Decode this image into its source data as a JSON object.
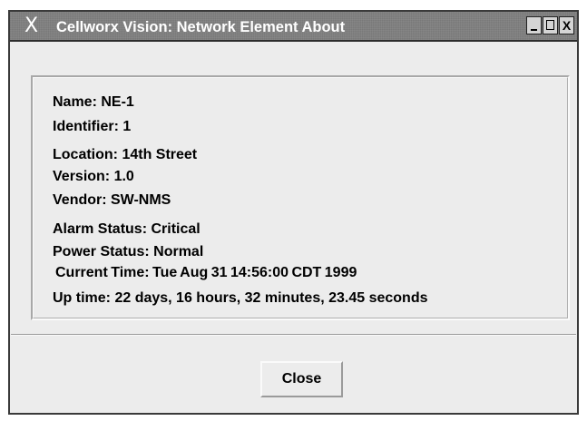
{
  "window": {
    "title": "Cellworx Vision: Network Element About",
    "system_icon_glyph": "X",
    "buttons": {
      "minimize": "",
      "maximize": "",
      "close": "X"
    }
  },
  "info": {
    "name": "Name: NE-1",
    "identifier": "Identifier:  1",
    "location": "Location:  14th Street",
    "version": "Version: 1.0",
    "vendor": "Vendor: SW-NMS",
    "alarm_status": "Alarm Status: Critical",
    "power_status": "Power Status:  Normal",
    "current_time": "Current Time: Tue Aug 31 14:56:00 CDT 1999",
    "up_time": "Up time: 22 days, 16 hours, 32 minutes, 23.45 seconds"
  },
  "actions": {
    "close_label": "Close"
  },
  "colors": {
    "titlebar": "#808080",
    "window_bg": "#ececec",
    "text": "#000000"
  }
}
